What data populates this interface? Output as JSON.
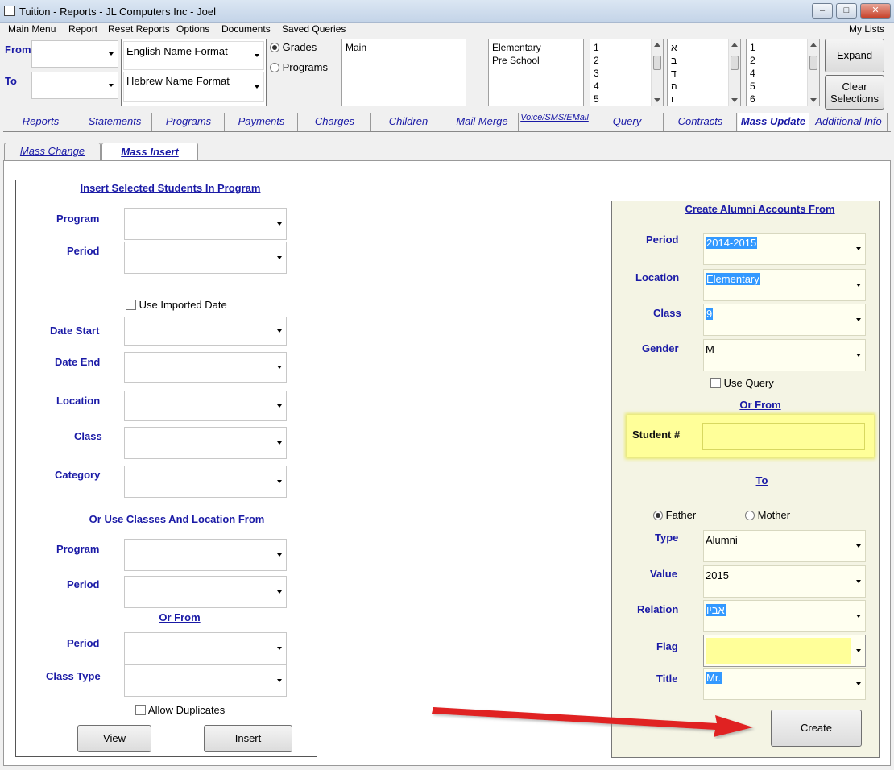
{
  "window": {
    "title": "Tuition - Reports - JL Computers Inc - Joel"
  },
  "menu": [
    "Main Menu",
    "Report",
    "Reset Reports",
    "Options",
    "Documents",
    "Saved Queries"
  ],
  "my_lists": "My Lists",
  "filters": {
    "from_label": "From",
    "to_label": "To",
    "english_format": "English Name Format",
    "hebrew_format": "Hebrew Name Format",
    "grades": "Grades",
    "programs": "Programs",
    "list_main": [
      "Main"
    ],
    "list_locations": [
      "Elementary",
      "Pre School"
    ],
    "list_grades": [
      "1",
      "2",
      "3",
      "4",
      "5"
    ],
    "list_hebrew": [
      "א",
      "ב",
      "ד",
      "ה",
      "ו"
    ],
    "list_nums": [
      "1",
      "2",
      "4",
      "5",
      "6"
    ],
    "expand": "Expand",
    "clear_selections": "Clear Selections"
  },
  "tabs": [
    "Reports",
    "Statements",
    "Programs",
    "Payments",
    "Charges",
    "Children",
    "Mail Merge",
    "Voice/SMS/EMail",
    "Query",
    "Contracts",
    "Mass Update",
    "Additional Info"
  ],
  "subtabs": [
    "Mass Change",
    "Mass Insert"
  ],
  "insert": {
    "header": "Insert Selected Students In Program",
    "program": "Program",
    "period": "Period",
    "use_imported_date": "Use Imported Date",
    "date_start": "Date Start",
    "date_end": "Date End",
    "location": "Location",
    "class": "Class",
    "category": "Category",
    "or_use_header": "Or Use Classes And Location From",
    "program2": "Program",
    "period2": "Period",
    "or_from": "Or From",
    "period3": "Period",
    "class_type": "Class Type",
    "allow_duplicates": "Allow Duplicates",
    "view": "View",
    "insert_btn": "Insert"
  },
  "alumni": {
    "header": "Create Alumni Accounts From",
    "period_label": "Period",
    "period_value": "2014-2015",
    "location_label": "Location",
    "location_value": "Elementary",
    "class_label": "Class",
    "class_value": "9",
    "gender_label": "Gender",
    "gender_value": "M",
    "use_query": "Use Query",
    "or_from": "Or From",
    "student_label": "Student #",
    "to": "To",
    "father": "Father",
    "mother": "Mother",
    "type_label": "Type",
    "type_value": "Alumni",
    "value_label": "Value",
    "value_value": "2015",
    "relation_label": "Relation",
    "relation_value": "אביו",
    "flag_label": "Flag",
    "title_label": "Title",
    "title_value": "Mr.",
    "create": "Create"
  },
  "colors": {
    "label_blue": "#1a1aa6",
    "highlight_yellow": "#ffff99",
    "arrow_red": "#e02020"
  }
}
